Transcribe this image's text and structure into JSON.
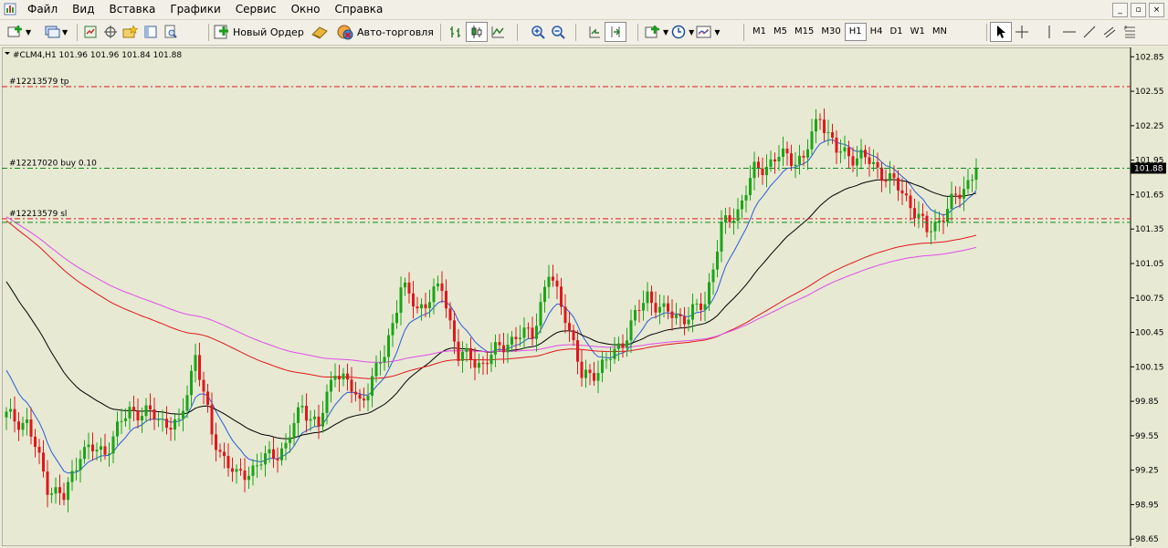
{
  "app": {
    "icon": "metatrader-app-icon"
  },
  "menu": {
    "items": [
      "Файл",
      "Вид",
      "Вставка",
      "Графики",
      "Сервис",
      "Окно",
      "Справка"
    ]
  },
  "window_controls": [
    "_",
    "▫",
    "×"
  ],
  "toolbar": {
    "new_order_label": "Новый Ордер",
    "autotrade_label": "Авто-торговля",
    "timeframes": [
      "M1",
      "M5",
      "M15",
      "M30",
      "H1",
      "H4",
      "D1",
      "W1",
      "MN"
    ],
    "active_timeframe": "H1"
  },
  "chart": {
    "header": "#CLM4,H1  101.96 101.96 101.84 101.88",
    "order_labels": [
      {
        "text": "#12213579 tp",
        "price": 102.59
      },
      {
        "text": "#12217020 buy 0.10",
        "price": 101.88
      },
      {
        "text": "#12213579 sl",
        "price": 101.44
      }
    ],
    "last_price_label": "101.88",
    "colors": {
      "background": "#e7e9d3",
      "bull": "#1aa516",
      "bear": "#e2161b",
      "tp_line": "#e2161b",
      "sl_line": "#e2161b",
      "buy_line": "#0f8a1a",
      "ma_fast": "#2a5bd7",
      "ma_mid": "#000000",
      "ma_slow": "#e2161b",
      "ma_slowest": "#e04ce8"
    }
  },
  "chart_data": {
    "type": "candlestick",
    "symbol": "#CLM4",
    "timeframe": "H1",
    "ylim": [
      98.62,
      102.9
    ],
    "y_ticks": [
      "102.85",
      "102.55",
      "102.25",
      "101.95",
      "101.65",
      "101.35",
      "101.05",
      "100.75",
      "100.45",
      "100.15",
      "99.85",
      "99.55",
      "99.25",
      "98.95",
      "98.65"
    ],
    "series_summary": [
      {
        "x": 0,
        "close": 99.72
      },
      {
        "x": 5,
        "close": 99.66
      },
      {
        "x": 10,
        "close": 99.12
      },
      {
        "x": 14,
        "close": 99.0
      },
      {
        "x": 18,
        "close": 99.42
      },
      {
        "x": 24,
        "close": 99.42
      },
      {
        "x": 30,
        "close": 99.78
      },
      {
        "x": 36,
        "close": 99.72
      },
      {
        "x": 42,
        "close": 99.62
      },
      {
        "x": 46,
        "close": 100.27
      },
      {
        "x": 50,
        "close": 99.55
      },
      {
        "x": 56,
        "close": 99.18
      },
      {
        "x": 62,
        "close": 99.32
      },
      {
        "x": 68,
        "close": 99.46
      },
      {
        "x": 72,
        "close": 99.82
      },
      {
        "x": 76,
        "close": 99.62
      },
      {
        "x": 80,
        "close": 100.15
      },
      {
        "x": 86,
        "close": 99.84
      },
      {
        "x": 92,
        "close": 100.25
      },
      {
        "x": 96,
        "close": 100.85
      },
      {
        "x": 100,
        "close": 100.66
      },
      {
        "x": 106,
        "close": 100.84
      },
      {
        "x": 110,
        "close": 100.25
      },
      {
        "x": 116,
        "close": 100.18
      },
      {
        "x": 122,
        "close": 100.38
      },
      {
        "x": 128,
        "close": 100.45
      },
      {
        "x": 132,
        "close": 100.95
      },
      {
        "x": 136,
        "close": 100.62
      },
      {
        "x": 140,
        "close": 100.05
      },
      {
        "x": 146,
        "close": 100.18
      },
      {
        "x": 150,
        "close": 100.38
      },
      {
        "x": 156,
        "close": 100.78
      },
      {
        "x": 160,
        "close": 100.62
      },
      {
        "x": 166,
        "close": 100.58
      },
      {
        "x": 170,
        "close": 100.72
      },
      {
        "x": 174,
        "close": 101.35
      },
      {
        "x": 178,
        "close": 101.52
      },
      {
        "x": 182,
        "close": 101.85
      },
      {
        "x": 188,
        "close": 101.98
      },
      {
        "x": 194,
        "close": 101.96
      },
      {
        "x": 198,
        "close": 102.35
      },
      {
        "x": 202,
        "close": 102.02
      },
      {
        "x": 208,
        "close": 101.98
      },
      {
        "x": 214,
        "close": 101.82
      },
      {
        "x": 220,
        "close": 101.58
      },
      {
        "x": 224,
        "close": 101.32
      },
      {
        "x": 228,
        "close": 101.48
      },
      {
        "x": 232,
        "close": 101.66
      },
      {
        "x": 236,
        "close": 101.88
      }
    ]
  }
}
